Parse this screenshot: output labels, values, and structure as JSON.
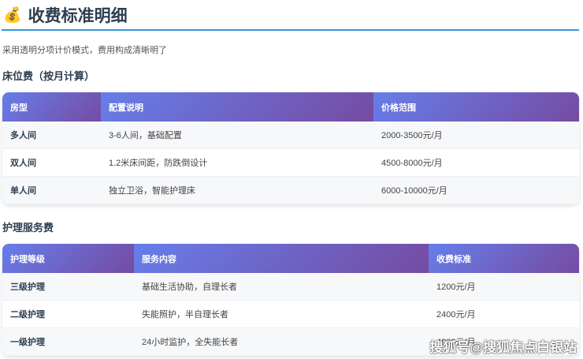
{
  "title": {
    "icon": "money-bag-icon",
    "glyph": "💰",
    "text": "收费标准明细"
  },
  "subtitle": "采用透明分项计价模式，费用构成清晰明了",
  "bed": {
    "heading": "床位费（按月计算）",
    "headers": [
      "房型",
      "配置说明",
      "价格范围"
    ],
    "rows": [
      [
        "多人间",
        "3-6人间，基础配置",
        "2000-3500元/月"
      ],
      [
        "双人间",
        "1.2米床间距，防跌倒设计",
        "4500-8000元/月"
      ],
      [
        "单人间",
        "独立卫浴，智能护理床",
        "6000-10000元/月"
      ]
    ]
  },
  "care": {
    "heading": "护理服务费",
    "headers": [
      "护理等级",
      "服务内容",
      "收费标准"
    ],
    "rows": [
      [
        "三级护理",
        "基础生活协助，自理长者",
        "1200元/月"
      ],
      [
        "二级护理",
        "失能照护，半自理长者",
        "2400元/月"
      ],
      [
        "一级护理",
        "24小时监护，全失能长者",
        "4800元/月"
      ]
    ]
  },
  "watermark": "搜狐号@搜狐焦点白银站"
}
